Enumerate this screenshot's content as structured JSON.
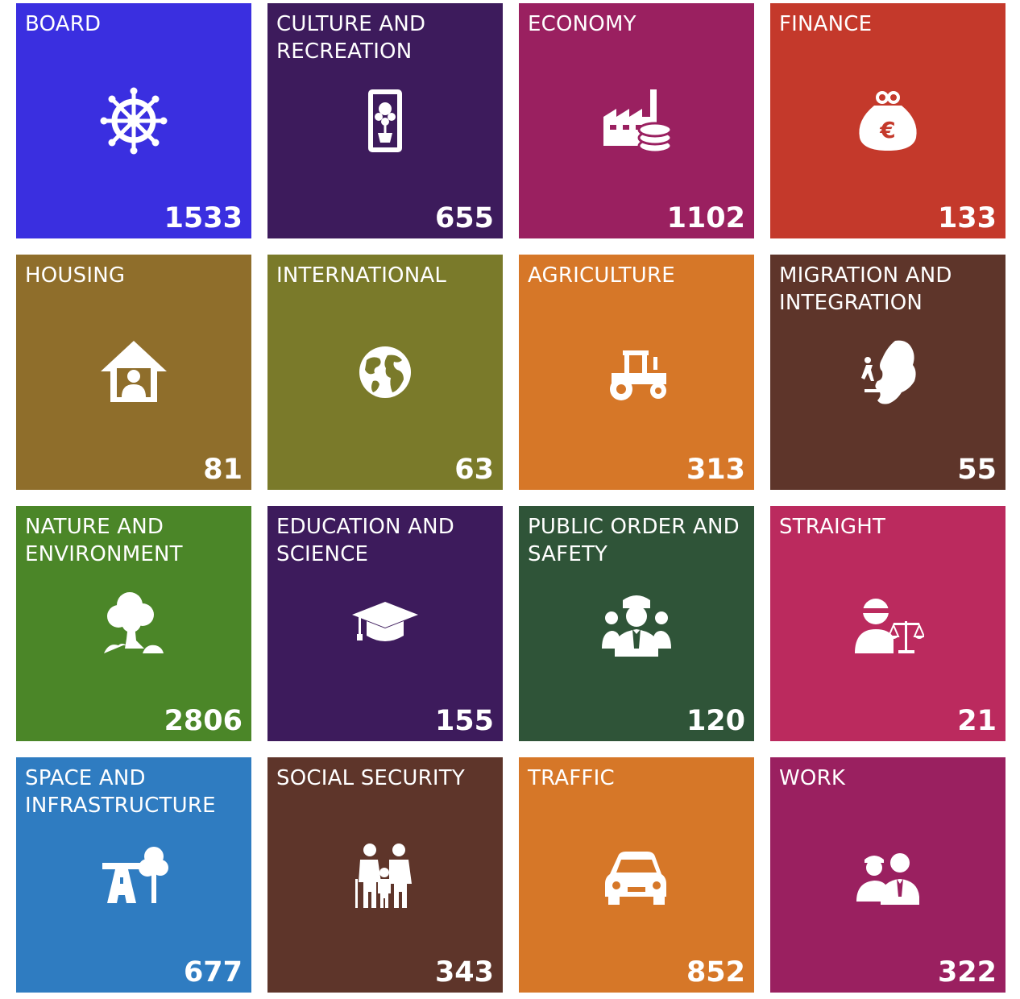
{
  "tiles": [
    {
      "title": "BOARD",
      "count": "1533",
      "color": "#3a2fe0",
      "icon": "ship-wheel-icon"
    },
    {
      "title": "CULTURE AND\nRECREATION",
      "count": "655",
      "color": "#3d1b5c",
      "icon": "framed-painting-icon"
    },
    {
      "title": "ECONOMY",
      "count": "1102",
      "color": "#9a2060",
      "icon": "factory-coins-icon"
    },
    {
      "title": "FINANCE",
      "count": "133",
      "color": "#c4392b",
      "icon": "euro-purse-icon"
    },
    {
      "title": "HOUSING",
      "count": "81",
      "color": "#8f6e2b",
      "icon": "house-person-icon"
    },
    {
      "title": "INTERNATIONAL",
      "count": "63",
      "color": "#7a7a2a",
      "icon": "globe-icon"
    },
    {
      "title": "AGRICULTURE",
      "count": "313",
      "color": "#d67728",
      "icon": "tractor-icon"
    },
    {
      "title": "MIGRATION AND\nINTEGRATION",
      "count": "55",
      "color": "#5e352a",
      "icon": "migration-map-icon"
    },
    {
      "title": "NATURE AND\nENVIRONMENT",
      "count": "2806",
      "color": "#4b8628",
      "icon": "tree-icon"
    },
    {
      "title": "EDUCATION AND\nSCIENCE",
      "count": "155",
      "color": "#3d1b5c",
      "icon": "graduation-cap-icon"
    },
    {
      "title": "PUBLIC ORDER AND\nSAFETY",
      "count": "120",
      "color": "#2f5438",
      "icon": "police-officer-icon"
    },
    {
      "title": "STRAIGHT",
      "count": "21",
      "color": "#bb2a5e",
      "icon": "justice-scales-icon"
    },
    {
      "title": "SPACE AND\nINFRASTRUCTURE",
      "count": "677",
      "color": "#2f7cc1",
      "icon": "road-tree-icon"
    },
    {
      "title": "SOCIAL SECURITY",
      "count": "343",
      "color": "#5e352a",
      "icon": "family-icon"
    },
    {
      "title": "TRAFFIC",
      "count": "852",
      "color": "#d67728",
      "icon": "car-icon"
    },
    {
      "title": "WORK",
      "count": "322",
      "color": "#9a2060",
      "icon": "workers-icon"
    }
  ]
}
